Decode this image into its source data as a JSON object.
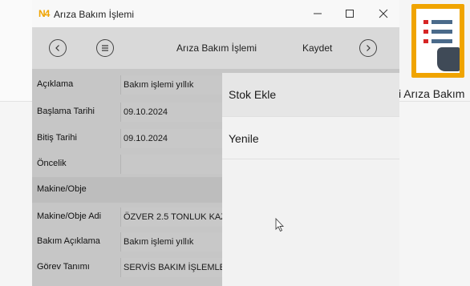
{
  "window": {
    "title": "Arıza Bakım İşlemi",
    "logo": "N4"
  },
  "toolbar": {
    "title": "Arıza Bakım İşlemi",
    "save_label": "Kaydet"
  },
  "form": {
    "rows": [
      {
        "label": "Açıklama",
        "value": "Bakım işlemi yıllık"
      },
      {
        "label": "Başlama Tarihi",
        "value": "09.10.2024"
      },
      {
        "label": "Bitiş Tarihi",
        "value": "09.10.2024"
      },
      {
        "label": "Öncelik",
        "value": ""
      },
      {
        "label": "Makine/Obje",
        "value": ""
      },
      {
        "label": "Makine/Obje Adi",
        "value": "ÖZVER 2.5 TONLUK KAZ"
      },
      {
        "label": "Bakım Açıklama",
        "value": "Bakım işlemi yıllık"
      },
      {
        "label": "Görev Tanımı",
        "value": "SERVİS BAKIM İŞLEMLER"
      }
    ]
  },
  "menu": {
    "items": [
      "Stok Ekle",
      "Yenile"
    ]
  },
  "background": {
    "app_label": "i Arıza Bakım",
    "accent": "#f0a400"
  }
}
